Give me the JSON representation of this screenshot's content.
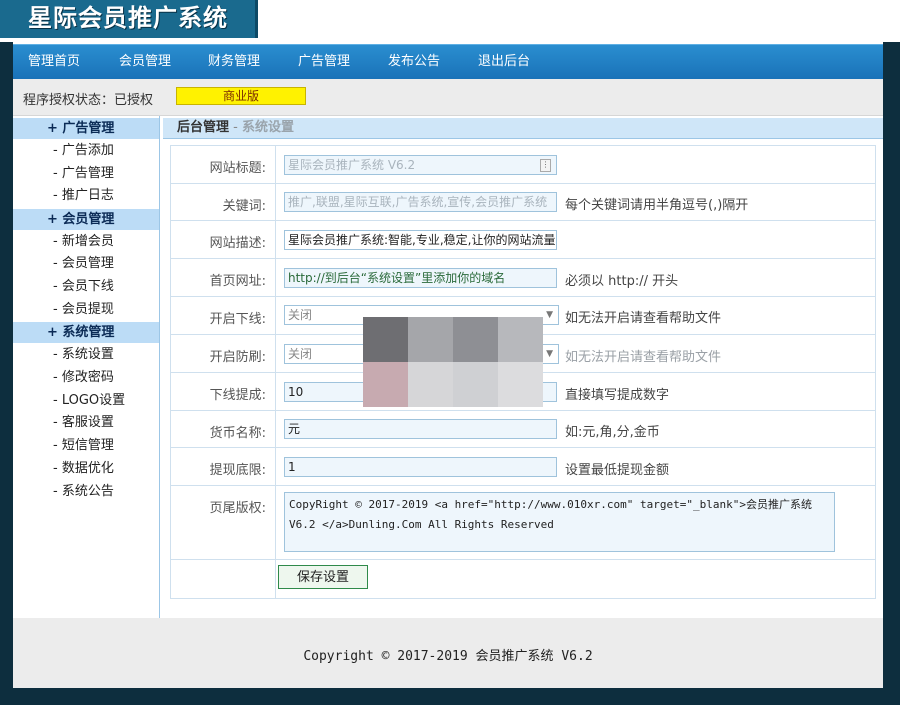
{
  "app": {
    "logo_text": "星际会员推广系统"
  },
  "nav": {
    "items": [
      "管理首页",
      "会员管理",
      "财务管理",
      "广告管理",
      "发布公告",
      "退出后台"
    ]
  },
  "status": {
    "label": "程序授权状态：已授权",
    "edition": "商业版"
  },
  "sidebar": {
    "sections": [
      {
        "title": "+ 广告管理",
        "items": [
          "- 广告添加",
          "- 广告管理",
          "- 推广日志"
        ]
      },
      {
        "title": "+ 会员管理",
        "items": [
          "- 新增会员",
          "- 会员管理",
          "- 会员下线",
          "- 会员提现"
        ]
      },
      {
        "title": "+ 系统管理",
        "items": [
          "- 系统设置",
          "- 修改密码",
          "- LOGO设置",
          "- 客服设置",
          "- 短信管理",
          "- 数据优化",
          "- 系统公告"
        ]
      }
    ]
  },
  "breadcrumb": {
    "root": "后台管理",
    "separator": " - ",
    "current": "系统设置"
  },
  "form": {
    "site_title": {
      "label": "网站标题:",
      "value": "星际会员推广系统 V6.2"
    },
    "keywords": {
      "label": "关键词:",
      "value": "推广,联盟,星际互联,广告系统,宣传,会员推广系统",
      "hint": "每个关键词请用半角逗号(,)隔开"
    },
    "description": {
      "label": "网站描述:",
      "value": "星际会员推广系统:智能,专业,稳定,让你的网站流量更"
    },
    "home_url": {
      "label": "首页网址:",
      "value": "http://到后台“系统设置”里添加你的域名",
      "hint": "必须以 http:// 开头"
    },
    "enable_downline": {
      "label": "开启下线:",
      "value": "关闭",
      "hint": "如无法开启请查看帮助文件"
    },
    "anti_refresh": {
      "label": "开启防刷:",
      "value": "关闭",
      "hint": "如无法开启请查看帮助文件"
    },
    "downline_commission": {
      "label": "下线提成:",
      "value": "10",
      "hint": "直接填写提成数字"
    },
    "currency": {
      "label": "货币名称:",
      "value": "元",
      "hint": "如:元,角,分,金币"
    },
    "min_withdraw": {
      "label": "提现底限:",
      "value": "1",
      "hint": "设置最低提现金额"
    },
    "footer_copyright": {
      "label": "页尾版权:",
      "value": "CopyRight © 2017-2019 <a href=\"http://www.010xr.com\" target=\"_blank\">会员推广系统 V6.2 </a>Dunling.Com All Rights Reserved"
    },
    "save_label": "保存设置"
  },
  "footer": {
    "copyright": "Copyright © 2017-2019 会员推广系统 V6.2"
  },
  "colors": {
    "nav_bg": "#1f7cc2",
    "sidebar_head": "#bcdcf6",
    "edition_badge": "#fff200",
    "page_bg": "#0d2e3e"
  }
}
